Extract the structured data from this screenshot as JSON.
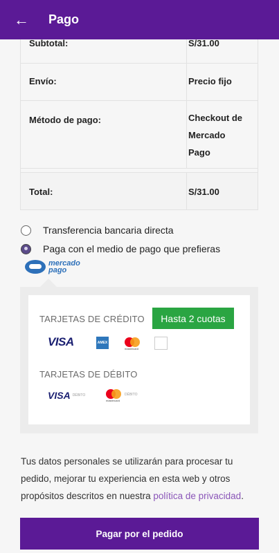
{
  "appbar": {
    "title": "Pago",
    "back_icon": "←"
  },
  "summary": [
    {
      "label": "Subtotal:",
      "value": "S/31.00"
    },
    {
      "label": "Envío:",
      "value": "Precio fijo"
    },
    {
      "label": "Método de pago:",
      "value_lines": [
        "Checkout de",
        "Mercado",
        "Pago"
      ]
    },
    {
      "label": "Total:",
      "value": "S/31.00"
    }
  ],
  "payment_options": [
    {
      "label": "Transferencia bancaria directa",
      "checked": false
    },
    {
      "label": "Paga con el medio de pago que prefieras",
      "checked": true
    }
  ],
  "mp_logo": {
    "line1": "mercado",
    "line2": "pago"
  },
  "mp_box": {
    "credit_title": "TARJETAS DE CRÉDITO",
    "cuotas_badge": "Hasta 2 cuotas",
    "debit_title": "TARJETAS DE DÉBITO",
    "visa_label": "VISA",
    "amex_label": "AMEX",
    "mastercard_label": "mastercard",
    "debito_label": "DÉBITO"
  },
  "privacy": {
    "text": "Tus datos personales se utilizarán para procesar tu pedido, mejorar tu experiencia en esta web y otros propósitos descritos en nuestra ",
    "link": "política de privacidad",
    "suffix": "."
  },
  "pay_button": {
    "label": "Pagar por el pedido"
  },
  "colors": {
    "brand": "#5b1a96",
    "success": "#2aa542",
    "link": "#8a55b8"
  }
}
